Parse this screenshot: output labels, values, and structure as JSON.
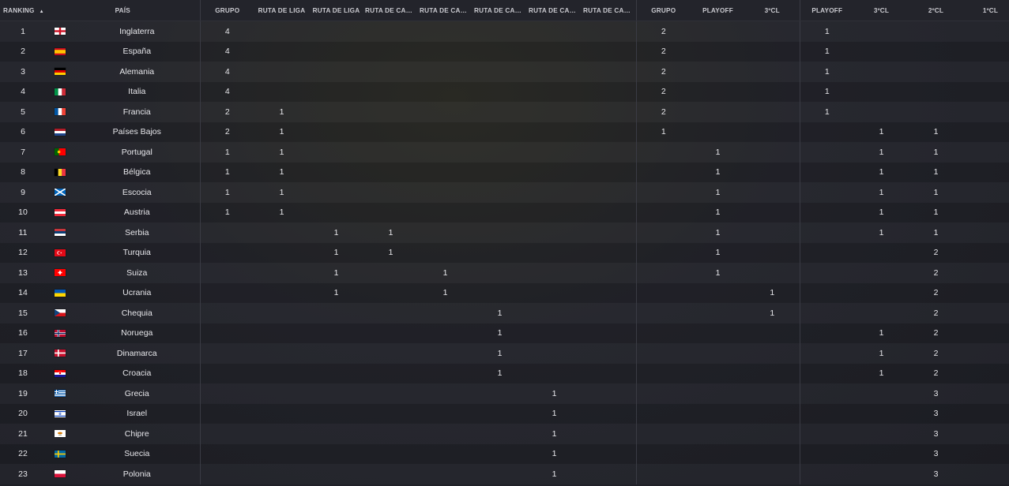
{
  "columns": [
    "RANKING",
    "PAÍS",
    "GRUPO",
    "RUTA DE LIGA",
    "RUTA DE LIGA",
    "RUTA DE CAMPEONES",
    "RUTA DE CAMPEONES",
    "RUTA DE CAMPEONES",
    "RUTA DE CAMPEONES",
    "RUTA DE CAMPEONES",
    "GRUPO",
    "PLAYOFF",
    "3ºCL",
    "PLAYOFF",
    "3ºCL",
    "2ºCL",
    "1ºCL"
  ],
  "column_display": [
    "RANKING",
    "PAÍS",
    "GRUPO",
    "RUTA DE LIGA",
    "RUTA DE LIGA",
    "RUTA DE CAMP...",
    "RUTA DE CAMP...",
    "RUTA DE CAMP...",
    "RUTA DE CAMP...",
    "RUTA DE CAMP...",
    "GRUPO",
    "PLAYOFF",
    "3ºCL",
    "PLAYOFF",
    "3ºCL",
    "2ºCL",
    "1ºCL"
  ],
  "sort_indicator": "▲",
  "flag_colors": {
    "inglaterra": "#ffffff",
    "espana": "#c60b1e",
    "alemania": "#dd0000",
    "italia": "#009246",
    "francia": "#0055a4",
    "paises-bajos": "#ae1c28",
    "portugal": "#006600",
    "belgica": "#fdda24",
    "escocia": "#0065bd",
    "austria": "#ed2939",
    "serbia": "#c6363c",
    "turquia": "#e30a17",
    "suiza": "#ff0000",
    "ucrania": "#0057b7",
    "chequia": "#11457e",
    "noruega": "#ba0c2f",
    "dinamarca": "#c8102e",
    "croacia": "#171796",
    "grecia": "#0d5eaf",
    "israel": "#0038b8",
    "chipre": "#d57800",
    "suecia": "#006aa7",
    "polonia": "#dc143c"
  },
  "rows": [
    {
      "rank": "1",
      "flag": "inglaterra",
      "country": "Inglaterra",
      "cells": [
        "4",
        "",
        "",
        "",
        "",
        "",
        "",
        "",
        "2",
        "",
        "",
        "1",
        "",
        "",
        ""
      ]
    },
    {
      "rank": "2",
      "flag": "espana",
      "country": "España",
      "cells": [
        "4",
        "",
        "",
        "",
        "",
        "",
        "",
        "",
        "2",
        "",
        "",
        "1",
        "",
        "",
        ""
      ]
    },
    {
      "rank": "3",
      "flag": "alemania",
      "country": "Alemania",
      "cells": [
        "4",
        "",
        "",
        "",
        "",
        "",
        "",
        "",
        "2",
        "",
        "",
        "1",
        "",
        "",
        ""
      ]
    },
    {
      "rank": "4",
      "flag": "italia",
      "country": "Italia",
      "cells": [
        "4",
        "",
        "",
        "",
        "",
        "",
        "",
        "",
        "2",
        "",
        "",
        "1",
        "",
        "",
        ""
      ]
    },
    {
      "rank": "5",
      "flag": "francia",
      "country": "Francia",
      "cells": [
        "2",
        "1",
        "",
        "",
        "",
        "",
        "",
        "",
        "2",
        "",
        "",
        "1",
        "",
        "",
        ""
      ]
    },
    {
      "rank": "6",
      "flag": "paises-bajos",
      "country": "Países Bajos",
      "cells": [
        "2",
        "1",
        "",
        "",
        "",
        "",
        "",
        "",
        "1",
        "",
        "",
        "",
        "1",
        "1",
        ""
      ]
    },
    {
      "rank": "7",
      "flag": "portugal",
      "country": "Portugal",
      "cells": [
        "1",
        "1",
        "",
        "",
        "",
        "",
        "",
        "",
        "",
        "1",
        "",
        "",
        "1",
        "1",
        ""
      ]
    },
    {
      "rank": "8",
      "flag": "belgica",
      "country": "Bélgica",
      "cells": [
        "1",
        "1",
        "",
        "",
        "",
        "",
        "",
        "",
        "",
        "1",
        "",
        "",
        "1",
        "1",
        ""
      ]
    },
    {
      "rank": "9",
      "flag": "escocia",
      "country": "Escocia",
      "cells": [
        "1",
        "1",
        "",
        "",
        "",
        "",
        "",
        "",
        "",
        "1",
        "",
        "",
        "1",
        "1",
        ""
      ]
    },
    {
      "rank": "10",
      "flag": "austria",
      "country": "Austria",
      "cells": [
        "1",
        "1",
        "",
        "",
        "",
        "",
        "",
        "",
        "",
        "1",
        "",
        "",
        "1",
        "1",
        ""
      ]
    },
    {
      "rank": "11",
      "flag": "serbia",
      "country": "Serbia",
      "cells": [
        "",
        "",
        "1",
        "1",
        "",
        "",
        "",
        "",
        "",
        "1",
        "",
        "",
        "1",
        "1",
        ""
      ]
    },
    {
      "rank": "12",
      "flag": "turquia",
      "country": "Turquia",
      "cells": [
        "",
        "",
        "1",
        "1",
        "",
        "",
        "",
        "",
        "",
        "1",
        "",
        "",
        "",
        "2",
        ""
      ]
    },
    {
      "rank": "13",
      "flag": "suiza",
      "country": "Suiza",
      "cells": [
        "",
        "",
        "1",
        "",
        "1",
        "",
        "",
        "",
        "",
        "1",
        "",
        "",
        "",
        "2",
        ""
      ]
    },
    {
      "rank": "14",
      "flag": "ucrania",
      "country": "Ucrania",
      "cells": [
        "",
        "",
        "1",
        "",
        "1",
        "",
        "",
        "",
        "",
        "",
        "1",
        "",
        "",
        "2",
        ""
      ]
    },
    {
      "rank": "15",
      "flag": "chequia",
      "country": "Chequia",
      "cells": [
        "",
        "",
        "",
        "",
        "",
        "1",
        "",
        "",
        "",
        "",
        "1",
        "",
        "",
        "2",
        ""
      ]
    },
    {
      "rank": "16",
      "flag": "noruega",
      "country": "Noruega",
      "cells": [
        "",
        "",
        "",
        "",
        "",
        "1",
        "",
        "",
        "",
        "",
        "",
        "",
        "1",
        "2",
        ""
      ]
    },
    {
      "rank": "17",
      "flag": "dinamarca",
      "country": "Dinamarca",
      "cells": [
        "",
        "",
        "",
        "",
        "",
        "1",
        "",
        "",
        "",
        "",
        "",
        "",
        "1",
        "2",
        ""
      ]
    },
    {
      "rank": "18",
      "flag": "croacia",
      "country": "Croacia",
      "cells": [
        "",
        "",
        "",
        "",
        "",
        "1",
        "",
        "",
        "",
        "",
        "",
        "",
        "1",
        "2",
        ""
      ]
    },
    {
      "rank": "19",
      "flag": "grecia",
      "country": "Grecia",
      "cells": [
        "",
        "",
        "",
        "",
        "",
        "",
        "1",
        "",
        "",
        "",
        "",
        "",
        "",
        "3",
        ""
      ]
    },
    {
      "rank": "20",
      "flag": "israel",
      "country": "Israel",
      "cells": [
        "",
        "",
        "",
        "",
        "",
        "",
        "1",
        "",
        "",
        "",
        "",
        "",
        "",
        "3",
        ""
      ]
    },
    {
      "rank": "21",
      "flag": "chipre",
      "country": "Chipre",
      "cells": [
        "",
        "",
        "",
        "",
        "",
        "",
        "1",
        "",
        "",
        "",
        "",
        "",
        "",
        "3",
        ""
      ]
    },
    {
      "rank": "22",
      "flag": "suecia",
      "country": "Suecia",
      "cells": [
        "",
        "",
        "",
        "",
        "",
        "",
        "1",
        "",
        "",
        "",
        "",
        "",
        "",
        "3",
        ""
      ]
    },
    {
      "rank": "23",
      "flag": "polonia",
      "country": "Polonia",
      "cells": [
        "",
        "",
        "",
        "",
        "",
        "",
        "1",
        "",
        "",
        "",
        "",
        "",
        "",
        "3",
        ""
      ]
    }
  ]
}
